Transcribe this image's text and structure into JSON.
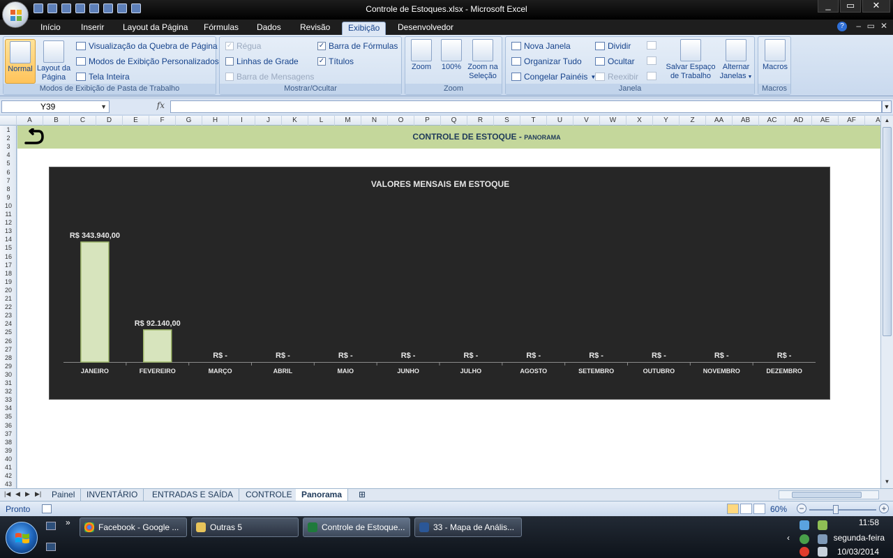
{
  "window": {
    "title": "Controle de Estoques.xlsx - Microsoft Excel",
    "controls": [
      "_",
      "▭",
      "✕"
    ]
  },
  "ribbon_tabs": [
    "Início",
    "Inserir",
    "Layout da Página",
    "Fórmulas",
    "Dados",
    "Revisão",
    "Exibição",
    "Desenvolvedor"
  ],
  "active_tab": "Exibição",
  "ribbon": {
    "modos": {
      "title": "Modos de Exibição de Pasta de Trabalho",
      "normal": "Normal",
      "layout": "Layout da Página",
      "quebra": "Visualização da Quebra de Página",
      "personalizados": "Modos de Exibição Personalizados",
      "tela_inteira": "Tela Inteira"
    },
    "mostrar": {
      "title": "Mostrar/Ocultar",
      "regua": "Régua",
      "linhas_grade": "Linhas de Grade",
      "barra_mensagens": "Barra de Mensagens",
      "barra_formulas": "Barra de Fórmulas",
      "titulos": "Títulos"
    },
    "zoom": {
      "title": "Zoom",
      "zoom": "Zoom",
      "cem": "100%",
      "zoom_selecao": "Zoom na Seleção"
    },
    "janela": {
      "title": "Janela",
      "nova_janela": "Nova Janela",
      "organizar": "Organizar Tudo",
      "congelar": "Congelar Painéis",
      "dividir": "Dividir",
      "ocultar": "Ocultar",
      "reexibir": "Reexibir",
      "salvar_espaco": "Salvar Espaço de Trabalho",
      "alternar": "Alternar Janelas"
    },
    "macros": {
      "title": "Macros",
      "macros": "Macros"
    }
  },
  "formula_bar": {
    "name_box": "Y39",
    "fx": "fx",
    "formula": ""
  },
  "columns": [
    "A",
    "B",
    "C",
    "D",
    "E",
    "F",
    "G",
    "H",
    "I",
    "J",
    "K",
    "L",
    "M",
    "N",
    "O",
    "P",
    "Q",
    "R",
    "S",
    "T",
    "U",
    "V",
    "W",
    "X",
    "Y",
    "Z",
    "AA",
    "AB",
    "AC",
    "AD",
    "AE",
    "AF",
    "A"
  ],
  "rows": [
    "1",
    "2",
    "3",
    "4",
    "5",
    "6",
    "7",
    "8",
    "9",
    "10",
    "11",
    "12",
    "13",
    "14",
    "15",
    "16",
    "17",
    "18",
    "19",
    "20",
    "21",
    "22",
    "23",
    "24",
    "25",
    "26",
    "27",
    "28",
    "29",
    "30",
    "31",
    "32",
    "33",
    "34",
    "35",
    "36",
    "37",
    "38",
    "39",
    "40",
    "41",
    "42",
    "43"
  ],
  "banner": {
    "title": "CONTROLE DE ESTOQUE -",
    "subtitle": "PANORAMA",
    "color": "#c4d79b"
  },
  "chart_data": {
    "type": "bar",
    "title": "VALORES MENSAIS EM ESTOQUE",
    "categories": [
      "JANEIRO",
      "FEVEREIRO",
      "MARÇO",
      "ABRIL",
      "MAIO",
      "JUNHO",
      "JULHO",
      "AGOSTO",
      "SETEMBRO",
      "OUTUBRO",
      "NOVEMBRO",
      "DEZEMBRO"
    ],
    "values": [
      343940,
      92140,
      0,
      0,
      0,
      0,
      0,
      0,
      0,
      0,
      0,
      0
    ],
    "labels": [
      "R$ 343.940,00",
      "R$ 92.140,00",
      "R$ -",
      "R$ -",
      "R$ -",
      "R$ -",
      "R$ -",
      "R$ -",
      "R$ -",
      "R$ -",
      "R$ -",
      "R$ -"
    ],
    "ylim": [
      0,
      343940
    ],
    "bar_color": "#d7e4bd",
    "background": "#262626",
    "grid": false,
    "legend": "none"
  },
  "sheet_tabs": [
    "Painel",
    "INVENTÁRIO",
    "ENTRADAS E SAÍDA",
    "CONTROLE",
    "Panorama"
  ],
  "active_sheet": "Panorama",
  "status": {
    "ready": "Pronto",
    "zoom": "60%"
  },
  "taskbar": {
    "buttons": [
      "Facebook - Google ...",
      "Outras 5",
      "Controle de Estoque...",
      "33 - Mapa de Anális..."
    ],
    "time": "11:58",
    "weekday": "segunda-feira",
    "date": "10/03/2014"
  }
}
